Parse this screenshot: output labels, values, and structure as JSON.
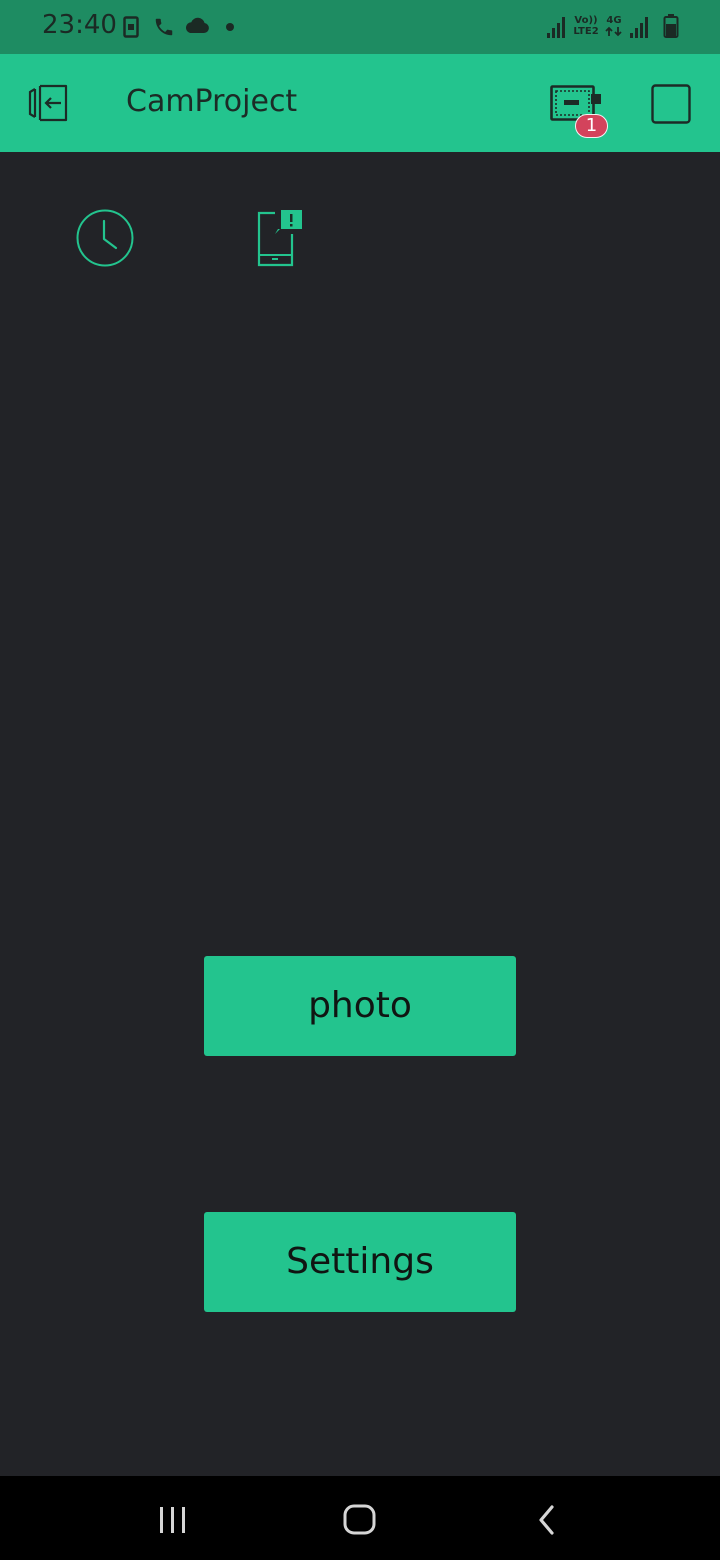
{
  "status_bar": {
    "time": "23:40",
    "volte_label_top": "Vo))",
    "volte_label_bottom": "LTE2",
    "network_label": "4G",
    "icons": [
      "sim-icon",
      "phone-icon",
      "cloud-icon",
      "dot-icon",
      "signal-icon",
      "signal-icon-2",
      "battery-icon"
    ]
  },
  "app_bar": {
    "title": "CamProject",
    "badge_count": "1",
    "icons": [
      "exit-icon",
      "device-icon",
      "stop-icon"
    ]
  },
  "widgets": {
    "icons": [
      "clock-icon",
      "notification-icon"
    ]
  },
  "buttons": {
    "photo_label": "photo",
    "settings_label": "Settings"
  },
  "nav_bar": {
    "icons": [
      "recents-icon",
      "home-icon",
      "back-icon"
    ]
  },
  "colors": {
    "status_bar": "#1e8c62",
    "accent": "#23c48e",
    "background": "#222327",
    "badge": "#d3435c",
    "nav_bar": "#000000"
  }
}
